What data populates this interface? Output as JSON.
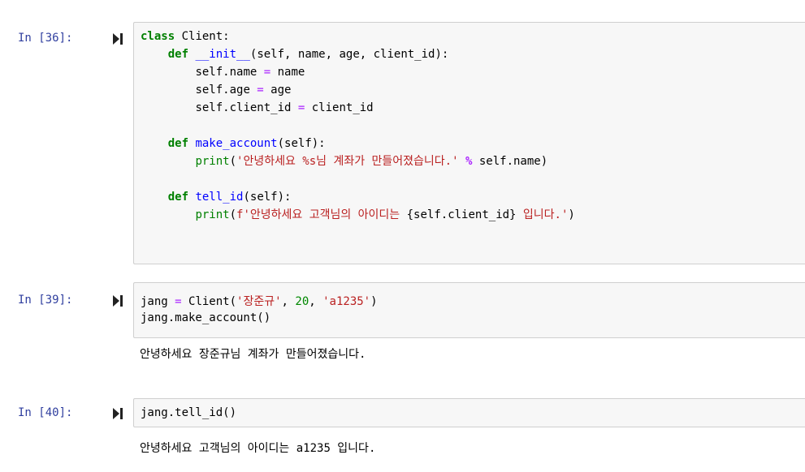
{
  "cells": [
    {
      "prompt": "In [36]:",
      "code": {
        "l1_kw": "class",
        "l1_name": " Client:",
        "l2_kw": "def",
        "l2_fn": "__init__",
        "l2_rest": "(self, name, age, client_id):",
        "l3_a": "self.name ",
        "l3_eq": "=",
        "l3_b": " name",
        "l4_a": "self.age ",
        "l4_eq": "=",
        "l4_b": " age",
        "l5_a": "self.client_id ",
        "l5_eq": "=",
        "l5_b": " client_id",
        "l7_kw": "def",
        "l7_fn": "make_account",
        "l7_rest": "(self):",
        "l8_print": "print",
        "l8_p1": "(",
        "l8_str": "'안녕하세요 %s님 계좌가 만들어졌습니다.'",
        "l8_op": "%",
        "l8_rest": " self.name)",
        "l10_kw": "def",
        "l10_fn": "tell_id",
        "l10_rest": "(self):",
        "l11_print": "print",
        "l11_p1": "(",
        "l11_str1": "f'안녕하세요 고객님의 아이디는 ",
        "l11_interp": "{self.client_id}",
        "l11_str2": " 입니다.'",
        "l11_end": ")"
      }
    },
    {
      "prompt": "In [39]:",
      "code": {
        "l1_a": "jang ",
        "l1_eq": "=",
        "l1_b": " Client(",
        "l1_s1": "'장준규'",
        "l1_c1": ", ",
        "l1_n": "20",
        "l1_c2": ", ",
        "l1_s2": "'a1235'",
        "l1_end": ")",
        "l2": "jang.make_account()"
      },
      "output": "안녕하세요 장준규님 계좌가 만들어졌습니다."
    },
    {
      "prompt": "In [40]:",
      "code": {
        "l1": "jang.tell_id()"
      },
      "output": "안녕하세요 고객님의 아이디는 a1235 입니다."
    }
  ],
  "icons": {
    "run": "run-cell-icon"
  },
  "colors": {
    "prompt": "#303f9f",
    "keyword": "#008000",
    "function": "#0000ff",
    "string": "#ba2121",
    "number": "#008800",
    "operator": "#aa22ff",
    "input_bg": "#f7f7f7",
    "input_border": "#cfcfcf"
  }
}
